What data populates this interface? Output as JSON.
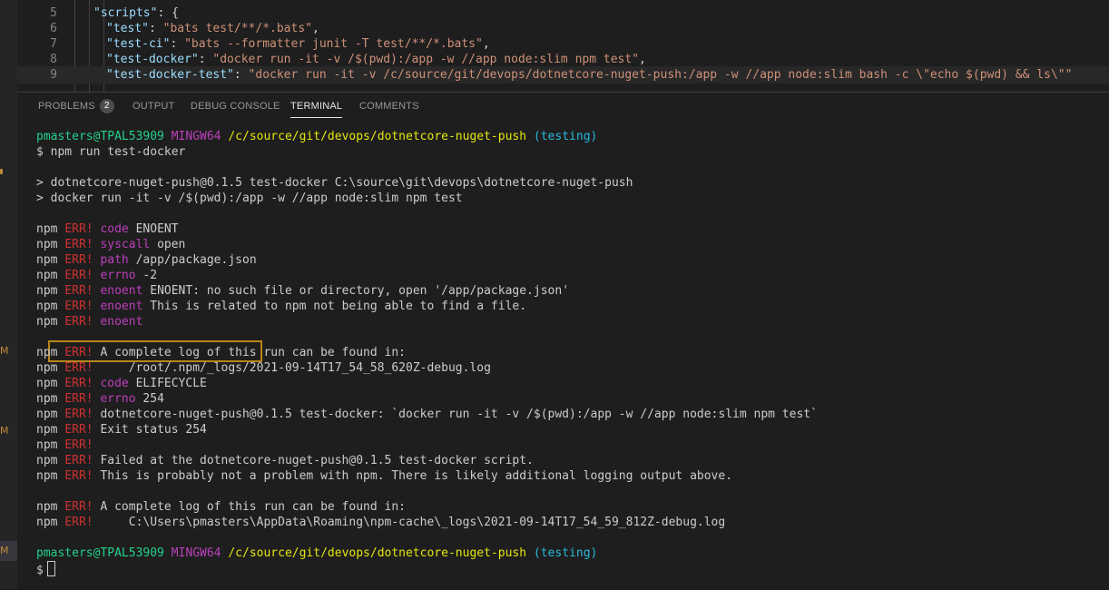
{
  "editor": {
    "lines": [
      {
        "num": "5",
        "key": "\"scripts\"",
        "sep": ": ",
        "value": "{",
        "comma": "",
        "indent": 1
      },
      {
        "num": "6",
        "key": "\"test\"",
        "sep": ": ",
        "value": "\"bats test/**/*.bats\"",
        "comma": ",",
        "indent": 2
      },
      {
        "num": "7",
        "key": "\"test-ci\"",
        "sep": ": ",
        "value": "\"bats --formatter junit -T test/**/*.bats\"",
        "comma": ",",
        "indent": 2
      },
      {
        "num": "8",
        "key": "\"test-docker\"",
        "sep": ": ",
        "value": "\"docker run -it -v /$(pwd):/app -w //app node:slim npm test\"",
        "comma": ",",
        "indent": 2
      },
      {
        "num": "9",
        "key": "\"test-docker-test\"",
        "sep": ": ",
        "value": "\"docker run -it -v /c/source/git/devops/dotnetcore-nuget-push:/app -w //app node:slim bash -c \\\"echo $(pwd) && ls\\\"\"",
        "comma": "",
        "indent": 2
      }
    ]
  },
  "panel": {
    "tabs": [
      {
        "label": "PROBLEMS",
        "badge": "2",
        "active": false
      },
      {
        "label": "OUTPUT",
        "active": false
      },
      {
        "label": "DEBUG CONSOLE",
        "active": false
      },
      {
        "label": "TERMINAL",
        "active": true
      },
      {
        "label": "COMMENTS",
        "active": false
      }
    ]
  },
  "terminal": {
    "prompt1": {
      "user": "pmasters@TPAL53909",
      "host": "MINGW64",
      "path": "/c/source/git/devops/dotnetcore-nuget-push",
      "branch": "(testing)"
    },
    "command": "$ npm run test-docker",
    "script_lines": [
      "> dotnetcore-nuget-push@0.1.5 test-docker C:\\source\\git\\devops\\dotnetcore-nuget-push",
      "> docker run -it -v /$(pwd):/app -w //app node:slim npm test"
    ],
    "err_block1": [
      {
        "npm": "npm",
        "err": "ERR!",
        "kw": "code",
        "text": " ENOENT"
      },
      {
        "npm": "npm",
        "err": "ERR!",
        "kw": "syscall",
        "text": " open"
      },
      {
        "npm": "npm",
        "err": "ERR!",
        "kw": "path",
        "text": " /app/package.json"
      },
      {
        "npm": "npm",
        "err": "ERR!",
        "kw": "errno",
        "text": " -2"
      },
      {
        "npm": "npm",
        "err": "ERR!",
        "kw": "enoent",
        "text": " ENOENT: no such file or directory, open '/app/package.json'"
      },
      {
        "npm": "npm",
        "err": "ERR!",
        "kw": "enoent",
        "text": " This is related to npm not being able to find a file."
      },
      {
        "npm": "npm",
        "err": "ERR!",
        "kw": "enoent",
        "text": ""
      }
    ],
    "err_block2": [
      {
        "npm": "npm",
        "err": "ERR!",
        "kw": "",
        "text": " A complete log of this run can be found in:"
      },
      {
        "npm": "npm",
        "err": "ERR!",
        "kw": "",
        "text": "     /root/.npm/_logs/2021-09-14T17_54_58_620Z-debug.log"
      },
      {
        "npm": "npm",
        "err": "ERR!",
        "kw": "code",
        "text": " ELIFECYCLE"
      },
      {
        "npm": "npm",
        "err": "ERR!",
        "kw": "errno",
        "text": " 254"
      },
      {
        "npm": "npm",
        "err": "ERR!",
        "kw": "",
        "text": " dotnetcore-nuget-push@0.1.5 test-docker: `docker run -it -v /$(pwd):/app -w //app node:slim npm test`"
      },
      {
        "npm": "npm",
        "err": "ERR!",
        "kw": "",
        "text": " Exit status 254"
      },
      {
        "npm": "npm",
        "err": "ERR!",
        "kw": "",
        "text": ""
      },
      {
        "npm": "npm",
        "err": "ERR!",
        "kw": "",
        "text": " Failed at the dotnetcore-nuget-push@0.1.5 test-docker script."
      },
      {
        "npm": "npm",
        "err": "ERR!",
        "kw": "",
        "text": " This is probably not a problem with npm. There is likely additional logging output above."
      }
    ],
    "err_block3": [
      {
        "npm": "npm",
        "err": "ERR!",
        "kw": "",
        "text": " A complete log of this run can be found in:"
      },
      {
        "npm": "npm",
        "err": "ERR!",
        "kw": "",
        "text": "     C:\\Users\\pmasters\\AppData\\Roaming\\npm-cache\\_logs\\2021-09-14T17_54_59_812Z-debug.log"
      }
    ],
    "prompt2": {
      "user": "pmasters@TPAL53909",
      "host": "MINGW64",
      "path": "/c/source/git/devops/dotnetcore-nuget-push",
      "branch": "(testing)"
    },
    "final_prompt": "$"
  },
  "gutter": {
    "markers": [
      "M",
      "M",
      "M"
    ]
  },
  "colors": {
    "highlight_box": "#b8861b",
    "err": "#cd3131",
    "user": "#23d18b",
    "host": "#bc3fbc",
    "path": "#e5e510",
    "branch": "#29b8db"
  }
}
